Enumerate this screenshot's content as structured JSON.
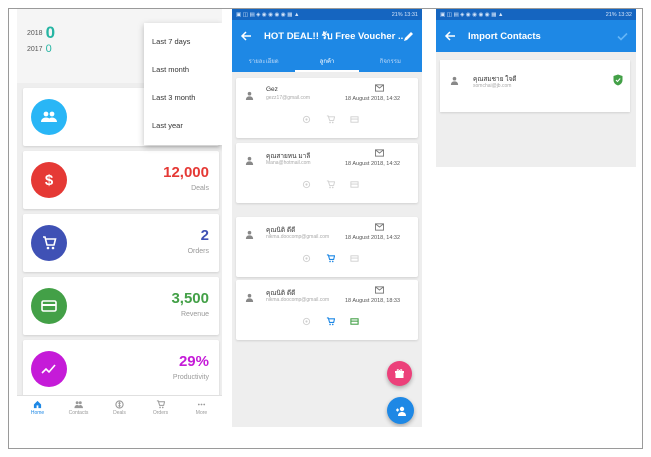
{
  "screen1": {
    "years": [
      {
        "label": "2018",
        "value": "0"
      },
      {
        "label": "2017",
        "value": "0"
      }
    ],
    "dropdown": [
      "Last 7 days",
      "Last month",
      "Last 3 month",
      "Last year"
    ],
    "cards": [
      {
        "icon": "users-icon",
        "value": "",
        "label": "",
        "color": "#29b6f6"
      },
      {
        "icon": "dollar-icon",
        "value": "12,000",
        "label": "Deals",
        "color": "#e53935"
      },
      {
        "icon": "cart-icon",
        "value": "2",
        "label": "Orders",
        "color": "#3f51b5"
      },
      {
        "icon": "card-icon",
        "value": "3,500",
        "label": "Revenue",
        "color": "#43a047"
      },
      {
        "icon": "trend-icon",
        "value": "29%",
        "label": "Productivity",
        "color": "#c51bd8"
      }
    ],
    "nav": [
      {
        "icon": "home-icon",
        "label": "Home"
      },
      {
        "icon": "contacts-icon",
        "label": "Contacts"
      },
      {
        "icon": "deals-icon",
        "label": "Deals"
      },
      {
        "icon": "orders-icon",
        "label": "Orders"
      },
      {
        "icon": "more-icon",
        "label": "More"
      }
    ]
  },
  "screen2": {
    "status": "21% 13:31",
    "title": "HOT DEAL!! รับ Free Voucher ...",
    "tabs": [
      "รายละเอียด",
      "ลูกค้า",
      "กิจกรรม"
    ],
    "items": [
      {
        "name": "Gez",
        "email": "gezz17@gmail.com",
        "date": "18 August 2018, 14:32"
      },
      {
        "name": "คุณสายหน มาลี",
        "email": "Mana@hotmail.com",
        "date": "18 August 2018, 14:32"
      },
      {
        "name": "คุณนิติ ดีดี",
        "email": "nikma.doocomp@gmail.com",
        "date": "18 August 2018, 14:32"
      },
      {
        "name": "คุณนิติ ดีดี",
        "email": "nikma.doocomp@gmail.com",
        "date": "18 August 2018, 18:33"
      }
    ]
  },
  "screen3": {
    "status": "21% 13:32",
    "title": "Import Contacts",
    "contact": {
      "name": "คุณสมชาย ใจดี",
      "email": "somchai@jb.com"
    }
  },
  "colors": {
    "primary": "#1e88e5",
    "statusbar": "#1565c0",
    "pink": "#ec407a",
    "teal": "#26b5a3",
    "green": "#43a047"
  }
}
